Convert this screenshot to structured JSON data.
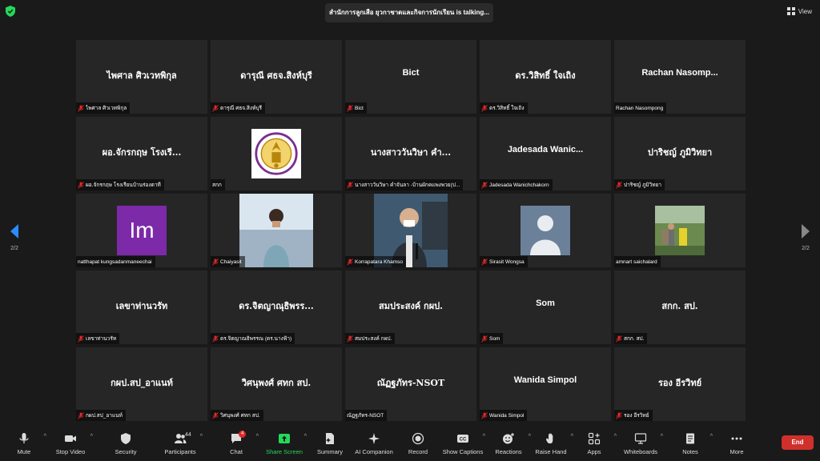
{
  "header": {
    "talking_text": "สำนักการลูกเสือ ยุวกาชาดและกิจการนักเรียน is talking...",
    "view_label": "View"
  },
  "pager": {
    "left": "2/2",
    "right": "2/2"
  },
  "tiles": [
    {
      "display": "ไพศาล ศิวเวทพิกุล",
      "name": "ไพศาล ศิวเวทพิกุล",
      "muted": true,
      "thai": true
    },
    {
      "display": "ดารุณี ศธจ.สิงห์บุรี",
      "name": "ดารุณี ศธจ.สิงห์บุรี",
      "muted": true,
      "thai": true
    },
    {
      "display": "Bict",
      "name": "Bict",
      "muted": true
    },
    {
      "display": "ดร.วิสิทธิ์ ใจเถิง",
      "name": "ดร.วิสิทธิ์ ใจเถิง",
      "muted": true,
      "thai": true
    },
    {
      "display": "Rachan  Nasomp...",
      "name": "Rachan Nasompong",
      "muted": false
    },
    {
      "display": "ผอ.จักรกฤษ โรงเรี...",
      "name": "ผอ.จักรกฤษ โรงเรียนบ้านร่องตาที",
      "muted": true,
      "thai": true
    },
    {
      "display": "",
      "name": "สกก",
      "muted": false,
      "image": "seal"
    },
    {
      "display": "นางสาววันวิษา คำ...",
      "name": "นางสาววันวิษา คำจันลา -บ้านผักคแพงพวย(ป...",
      "muted": true,
      "thai": true
    },
    {
      "display": "Jadesada  Wanic...",
      "name": "Jadesada Wanichchakorn",
      "muted": true
    },
    {
      "display": "ปาริชญ์ ภูมิวิทยา",
      "name": "ปาริชญ์ ภูมิวิทยา",
      "muted": true,
      "thai": true
    },
    {
      "display": "",
      "name": "natthapat kungsadanmaneechai",
      "muted": false,
      "image": "im",
      "image_text": "Im"
    },
    {
      "display": "",
      "name": "Chaiyasit",
      "muted": true,
      "image": "person-sea"
    },
    {
      "display": "",
      "name": "Korrapatara Khamso",
      "muted": true,
      "image": "person-mic"
    },
    {
      "display": "",
      "name": "Sirasit Wongsa",
      "muted": true,
      "image": "avatar"
    },
    {
      "display": "",
      "name": "amnart saichalard",
      "muted": false,
      "image": "outdoor"
    },
    {
      "display": "เลขาท่านวรัท",
      "name": "เลขาท่านวรัท",
      "muted": true,
      "thai": true
    },
    {
      "display": "ดร.จิตญาณุธิพรร...",
      "name": "ดร.จิตญาณธิพรรณ (ดร.นางฟ้า)",
      "muted": true,
      "thai": true
    },
    {
      "display": "สมประสงค์ กผป.",
      "name": "สมประสงค์ กผป.",
      "muted": true,
      "thai": true
    },
    {
      "display": "Som",
      "name": "Som",
      "muted": true
    },
    {
      "display": "สกก. สป.",
      "name": "สกก. สป.",
      "muted": true,
      "thai": true
    },
    {
      "display": "กผป.สป_อาแนท์",
      "name": "กผป.สป_อาแนท์",
      "muted": true,
      "thai": true
    },
    {
      "display": "วิศนุพงศ์ ศทก สป.",
      "name": "วิศนุพงศ์ ศทก สป.",
      "muted": true,
      "thai": true
    },
    {
      "display": "ณัฏฐภัทร-NSOT",
      "name": "ณัฏฐภัทร-NSOT",
      "muted": false,
      "thai": true
    },
    {
      "display": "Wanida Simpol",
      "name": "Wanida Simpol",
      "muted": true
    },
    {
      "display": "รอง อีรวิทย์",
      "name": "รอง อีรวิทย์",
      "muted": true,
      "thai": true
    }
  ],
  "toolbar": {
    "mute": "Mute",
    "stop_video": "Stop Video",
    "security": "Security",
    "participants": "Participants",
    "participants_count": "44",
    "chat": "Chat",
    "chat_badge": "4",
    "share_screen": "Share Screen",
    "summary": "Summary",
    "ai_companion": "AI Companion",
    "record": "Record",
    "show_captions": "Show Captions",
    "reactions": "Reactions",
    "raise_hand": "Raise Hand",
    "apps": "Apps",
    "whiteboards": "Whiteboards",
    "notes": "Notes",
    "more": "More",
    "end": "End"
  },
  "colors": {
    "share_green": "#23d959",
    "end_red": "#d0302b",
    "mute_red": "#e02828"
  }
}
